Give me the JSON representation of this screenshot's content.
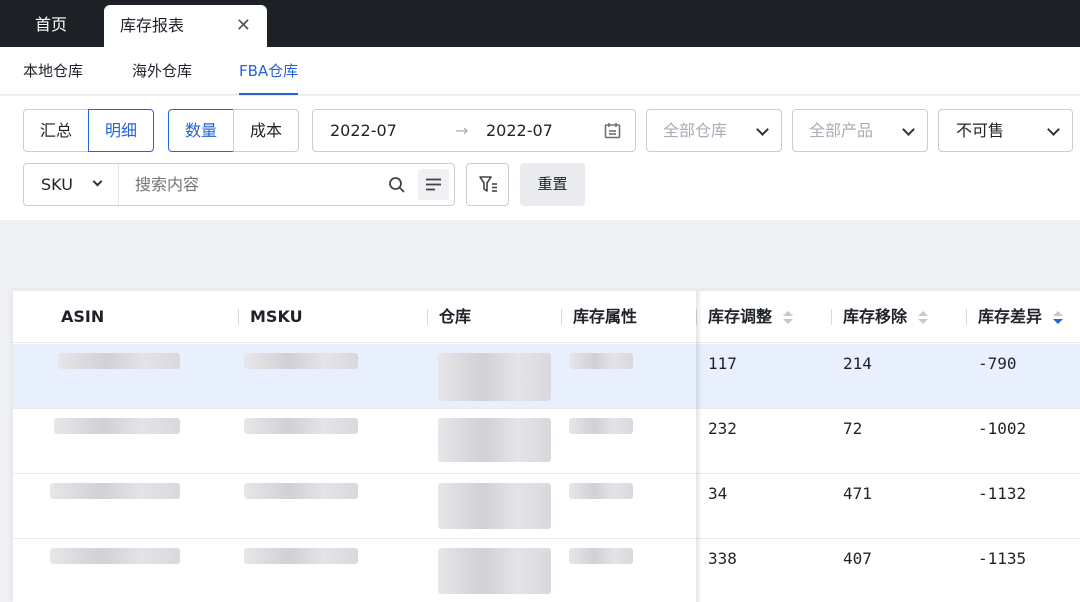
{
  "top_tabs": {
    "home": "首页",
    "active": "库存报表",
    "close": "✕"
  },
  "sub_tabs": [
    "本地仓库",
    "海外仓库",
    "FBA仓库"
  ],
  "filters": {
    "view_mode": [
      "汇总",
      "明细"
    ],
    "measure": [
      "数量",
      "成本"
    ],
    "date_start": "2022-07",
    "date_arrow": "→",
    "date_end": "2022-07",
    "warehouse_placeholder": "全部仓库",
    "product_placeholder": "全部产品",
    "sellable_value": "不可售",
    "search_field": "SKU",
    "search_placeholder": "搜索内容",
    "reset_label": "重置"
  },
  "table": {
    "columns": [
      "ASIN",
      "MSKU",
      "仓库",
      "库存属性",
      "库存调整",
      "库存移除",
      "库存差异"
    ],
    "rows": [
      {
        "adjust": "117",
        "remove": "214",
        "diff": "-790"
      },
      {
        "adjust": "232",
        "remove": "72",
        "diff": "-1002"
      },
      {
        "adjust": "34",
        "remove": "471",
        "diff": "-1132"
      },
      {
        "adjust": "338",
        "remove": "407",
        "diff": "-1135"
      }
    ]
  },
  "colors": {
    "accent": "#2563d9",
    "topbar": "#1d2025",
    "row_highlight": "#e8f0fd"
  }
}
